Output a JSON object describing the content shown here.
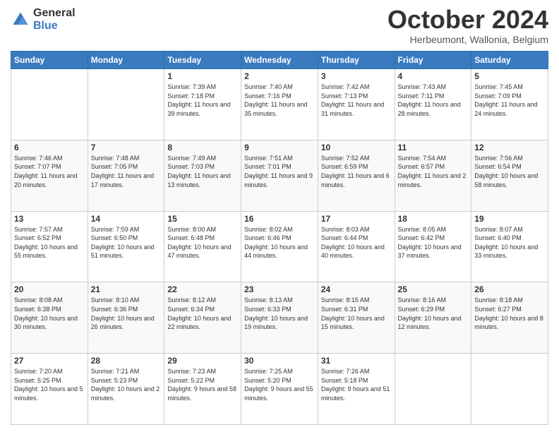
{
  "header": {
    "logo_general": "General",
    "logo_blue": "Blue",
    "month_title": "October 2024",
    "subtitle": "Herbeumont, Wallonia, Belgium"
  },
  "days_of_week": [
    "Sunday",
    "Monday",
    "Tuesday",
    "Wednesday",
    "Thursday",
    "Friday",
    "Saturday"
  ],
  "weeks": [
    [
      {
        "day": "",
        "info": ""
      },
      {
        "day": "",
        "info": ""
      },
      {
        "day": "1",
        "info": "Sunrise: 7:39 AM\nSunset: 7:18 PM\nDaylight: 11 hours and 39 minutes."
      },
      {
        "day": "2",
        "info": "Sunrise: 7:40 AM\nSunset: 7:16 PM\nDaylight: 11 hours and 35 minutes."
      },
      {
        "day": "3",
        "info": "Sunrise: 7:42 AM\nSunset: 7:13 PM\nDaylight: 11 hours and 31 minutes."
      },
      {
        "day": "4",
        "info": "Sunrise: 7:43 AM\nSunset: 7:11 PM\nDaylight: 11 hours and 28 minutes."
      },
      {
        "day": "5",
        "info": "Sunrise: 7:45 AM\nSunset: 7:09 PM\nDaylight: 11 hours and 24 minutes."
      }
    ],
    [
      {
        "day": "6",
        "info": "Sunrise: 7:46 AM\nSunset: 7:07 PM\nDaylight: 11 hours and 20 minutes."
      },
      {
        "day": "7",
        "info": "Sunrise: 7:48 AM\nSunset: 7:05 PM\nDaylight: 11 hours and 17 minutes."
      },
      {
        "day": "8",
        "info": "Sunrise: 7:49 AM\nSunset: 7:03 PM\nDaylight: 11 hours and 13 minutes."
      },
      {
        "day": "9",
        "info": "Sunrise: 7:51 AM\nSunset: 7:01 PM\nDaylight: 11 hours and 9 minutes."
      },
      {
        "day": "10",
        "info": "Sunrise: 7:52 AM\nSunset: 6:59 PM\nDaylight: 11 hours and 6 minutes."
      },
      {
        "day": "11",
        "info": "Sunrise: 7:54 AM\nSunset: 6:57 PM\nDaylight: 11 hours and 2 minutes."
      },
      {
        "day": "12",
        "info": "Sunrise: 7:56 AM\nSunset: 6:54 PM\nDaylight: 10 hours and 58 minutes."
      }
    ],
    [
      {
        "day": "13",
        "info": "Sunrise: 7:57 AM\nSunset: 6:52 PM\nDaylight: 10 hours and 55 minutes."
      },
      {
        "day": "14",
        "info": "Sunrise: 7:59 AM\nSunset: 6:50 PM\nDaylight: 10 hours and 51 minutes."
      },
      {
        "day": "15",
        "info": "Sunrise: 8:00 AM\nSunset: 6:48 PM\nDaylight: 10 hours and 47 minutes."
      },
      {
        "day": "16",
        "info": "Sunrise: 8:02 AM\nSunset: 6:46 PM\nDaylight: 10 hours and 44 minutes."
      },
      {
        "day": "17",
        "info": "Sunrise: 8:03 AM\nSunset: 6:44 PM\nDaylight: 10 hours and 40 minutes."
      },
      {
        "day": "18",
        "info": "Sunrise: 8:05 AM\nSunset: 6:42 PM\nDaylight: 10 hours and 37 minutes."
      },
      {
        "day": "19",
        "info": "Sunrise: 8:07 AM\nSunset: 6:40 PM\nDaylight: 10 hours and 33 minutes."
      }
    ],
    [
      {
        "day": "20",
        "info": "Sunrise: 8:08 AM\nSunset: 6:38 PM\nDaylight: 10 hours and 30 minutes."
      },
      {
        "day": "21",
        "info": "Sunrise: 8:10 AM\nSunset: 6:36 PM\nDaylight: 10 hours and 26 minutes."
      },
      {
        "day": "22",
        "info": "Sunrise: 8:12 AM\nSunset: 6:34 PM\nDaylight: 10 hours and 22 minutes."
      },
      {
        "day": "23",
        "info": "Sunrise: 8:13 AM\nSunset: 6:33 PM\nDaylight: 10 hours and 19 minutes."
      },
      {
        "day": "24",
        "info": "Sunrise: 8:15 AM\nSunset: 6:31 PM\nDaylight: 10 hours and 15 minutes."
      },
      {
        "day": "25",
        "info": "Sunrise: 8:16 AM\nSunset: 6:29 PM\nDaylight: 10 hours and 12 minutes."
      },
      {
        "day": "26",
        "info": "Sunrise: 8:18 AM\nSunset: 6:27 PM\nDaylight: 10 hours and 8 minutes."
      }
    ],
    [
      {
        "day": "27",
        "info": "Sunrise: 7:20 AM\nSunset: 5:25 PM\nDaylight: 10 hours and 5 minutes."
      },
      {
        "day": "28",
        "info": "Sunrise: 7:21 AM\nSunset: 5:23 PM\nDaylight: 10 hours and 2 minutes."
      },
      {
        "day": "29",
        "info": "Sunrise: 7:23 AM\nSunset: 5:22 PM\nDaylight: 9 hours and 58 minutes."
      },
      {
        "day": "30",
        "info": "Sunrise: 7:25 AM\nSunset: 5:20 PM\nDaylight: 9 hours and 55 minutes."
      },
      {
        "day": "31",
        "info": "Sunrise: 7:26 AM\nSunset: 5:18 PM\nDaylight: 9 hours and 51 minutes."
      },
      {
        "day": "",
        "info": ""
      },
      {
        "day": "",
        "info": ""
      }
    ]
  ]
}
